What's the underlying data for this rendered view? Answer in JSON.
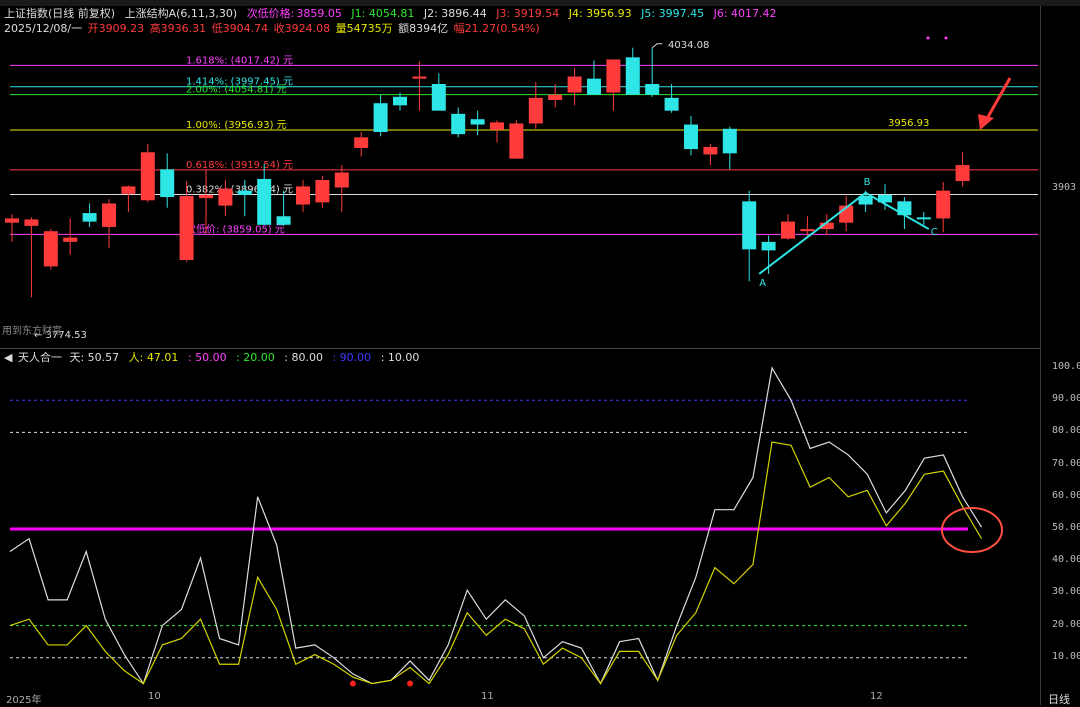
{
  "header1": {
    "index": "上证指数(日线 前复权)",
    "indicator": "上涨结构A(6,11,3,30)",
    "sub_label": "次低价格:",
    "sub_value": "3859.05",
    "j1": "J1: 4054.81",
    "j2": "J2: 3896.44",
    "j3": "J3: 3919.54",
    "j4": "J4: 3956.93",
    "j5": "J5: 3997.45",
    "j6": "J6: 4017.42"
  },
  "header2": {
    "date": "2025/12/08/一",
    "open": "开3909.23",
    "high": "高3936.31",
    "low": "低3904.74",
    "close": "收3924.08",
    "vol": "量54735万",
    "amount": "额8394亿",
    "amp": "幅21.27(0.54%)"
  },
  "fib_labels": [
    {
      "text": "1.618%:  (4017.42) 元",
      "color": "#ff40ff",
      "price": 4017.42
    },
    {
      "text": "1.414%:  (3997.45) 元",
      "color": "#2ee6e6",
      "price": 3997.45
    },
    {
      "text": "2.00%:  (4054.81) 元",
      "color": "#2ee62e",
      "price": 3990
    },
    {
      "text": "1.00%:  (3956.93) 元",
      "color": "#e8e800",
      "price": 3956.93
    },
    {
      "text": "0.618%:  (3919.54) 元",
      "color": "#ff3b3b",
      "price": 3919.54
    },
    {
      "text": "0.382%:  (3896.44) 元",
      "color": "#dddddd",
      "price": 3896.44
    },
    {
      "text": "次低价:  (3859.05) 元",
      "color": "#ff40ff",
      "price": 3859.05
    }
  ],
  "annotations": {
    "high_label": "4034.08",
    "low_label": "3774.53",
    "price_tag": "3956.93",
    "right_price": "3903",
    "point_a": "A",
    "point_b": "B",
    "point_c": "C",
    "mini_text": "用到东方财富"
  },
  "lower_header": {
    "name": "天人合一",
    "tian": "天: 50.57",
    "ren": "人: 47.01",
    "l50": ": 50.00",
    "l20": ": 20.00",
    "l80": ": 80.00",
    "l90": ": 90.00",
    "l10": ": 10.00"
  },
  "lower_ticks": [
    "100.0",
    "90.00",
    "80.00",
    "70.00",
    "60.00",
    "50.00",
    "40.00",
    "30.00",
    "20.00",
    "10.00"
  ],
  "date_labels": [
    "2025年",
    "10",
    "11",
    "12"
  ],
  "day_button": "日线",
  "colors": {
    "up": "#ff3b3b",
    "down": "#2ee6e6",
    "tian": "#dddddd",
    "ren": "#d4d400",
    "magenta": "#ff00ff"
  },
  "chart_data": [
    {
      "type": "candlestick",
      "title": "上证指数(日线 前复权)",
      "ylim": [
        3760,
        4045
      ],
      "candles": [
        {
          "o": 3870,
          "h": 3878,
          "l": 3852,
          "c": 3874
        },
        {
          "o": 3867,
          "h": 3875,
          "l": 3800,
          "c": 3873
        },
        {
          "o": 3829,
          "h": 3864,
          "l": 3826,
          "c": 3862
        },
        {
          "o": 3852,
          "h": 3874,
          "l": 3840,
          "c": 3856
        },
        {
          "o": 3879,
          "h": 3888,
          "l": 3866,
          "c": 3871
        },
        {
          "o": 3866,
          "h": 3892,
          "l": 3846,
          "c": 3888
        },
        {
          "o": 3897,
          "h": 3905,
          "l": 3880,
          "c": 3904
        },
        {
          "o": 3891,
          "h": 3944,
          "l": 3889,
          "c": 3936
        },
        {
          "o": 3920,
          "h": 3935,
          "l": 3884,
          "c": 3894
        },
        {
          "o": 3835,
          "h": 3909,
          "l": 3833,
          "c": 3895
        },
        {
          "o": 3893,
          "h": 3920,
          "l": 3860,
          "c": 3896
        },
        {
          "o": 3886,
          "h": 3910,
          "l": 3876,
          "c": 3902
        },
        {
          "o": 3900,
          "h": 3910,
          "l": 3876,
          "c": 3896
        },
        {
          "o": 3911,
          "h": 3925,
          "l": 3868,
          "c": 3868
        },
        {
          "o": 3876,
          "h": 3900,
          "l": 3867,
          "c": 3868
        },
        {
          "o": 3887,
          "h": 3910,
          "l": 3880,
          "c": 3904
        },
        {
          "o": 3889,
          "h": 3914,
          "l": 3884,
          "c": 3910
        },
        {
          "o": 3903,
          "h": 3924,
          "l": 3880,
          "c": 3917
        },
        {
          "o": 3940,
          "h": 3955,
          "l": 3932,
          "c": 3950
        },
        {
          "o": 3982,
          "h": 3990,
          "l": 3951,
          "c": 3955
        },
        {
          "o": 3988,
          "h": 3992,
          "l": 3975,
          "c": 3980
        },
        {
          "o": 4005,
          "h": 4021,
          "l": 3975,
          "c": 4007
        },
        {
          "o": 4000,
          "h": 4010,
          "l": 3975,
          "c": 3975
        },
        {
          "o": 3972,
          "h": 3978,
          "l": 3950,
          "c": 3953
        },
        {
          "o": 3967,
          "h": 3975,
          "l": 3952,
          "c": 3962
        },
        {
          "o": 3957,
          "h": 3966,
          "l": 3945,
          "c": 3964
        },
        {
          "o": 3930,
          "h": 3966,
          "l": 3930,
          "c": 3963
        },
        {
          "o": 3963,
          "h": 4002,
          "l": 3958,
          "c": 3987
        },
        {
          "o": 3985,
          "h": 4000,
          "l": 3978,
          "c": 3990
        },
        {
          "o": 3992,
          "h": 4015,
          "l": 3980,
          "c": 4007
        },
        {
          "o": 4005,
          "h": 4022,
          "l": 3990,
          "c": 3990
        },
        {
          "o": 3992,
          "h": 4010,
          "l": 3975,
          "c": 4023
        },
        {
          "o": 4025,
          "h": 4034,
          "l": 3990,
          "c": 3990
        },
        {
          "o": 4000,
          "h": 4034,
          "l": 3988,
          "c": 3990
        },
        {
          "o": 3987,
          "h": 4000,
          "l": 3973,
          "c": 3975
        },
        {
          "o": 3962,
          "h": 3970,
          "l": 3933,
          "c": 3939
        },
        {
          "o": 3934,
          "h": 3944,
          "l": 3924,
          "c": 3941
        },
        {
          "o": 3958,
          "h": 3960,
          "l": 3920,
          "c": 3935
        },
        {
          "o": 3890,
          "h": 3900,
          "l": 3815,
          "c": 3845
        },
        {
          "o": 3852,
          "h": 3858,
          "l": 3822,
          "c": 3844
        },
        {
          "o": 3855,
          "h": 3878,
          "l": 3854,
          "c": 3871
        },
        {
          "o": 3862,
          "h": 3876,
          "l": 3857,
          "c": 3864
        },
        {
          "o": 3864,
          "h": 3878,
          "l": 3858,
          "c": 3870
        },
        {
          "o": 3870,
          "h": 3895,
          "l": 3862,
          "c": 3886
        },
        {
          "o": 3895,
          "h": 3900,
          "l": 3880,
          "c": 3887
        },
        {
          "o": 3896,
          "h": 3906,
          "l": 3882,
          "c": 3889
        },
        {
          "o": 3890,
          "h": 3894,
          "l": 3864,
          "c": 3877
        },
        {
          "o": 3875,
          "h": 3880,
          "l": 3868,
          "c": 3874
        },
        {
          "o": 3874,
          "h": 3908,
          "l": 3861,
          "c": 3900
        },
        {
          "o": 3909,
          "h": 3936,
          "l": 3904,
          "c": 3924
        }
      ]
    },
    {
      "type": "line",
      "title": "天人合一",
      "ylim": [
        0,
        100
      ],
      "hlines": [
        {
          "name": "50.00",
          "value": 50,
          "color": "#ff00ff"
        },
        {
          "name": "20.00",
          "value": 20,
          "color": "#2ee62e"
        },
        {
          "name": "80.00",
          "value": 80,
          "color": "#dddddd"
        },
        {
          "name": "90.00",
          "value": 90,
          "color": "#3a3aff"
        },
        {
          "name": "10.00",
          "value": 10,
          "color": "#dddddd"
        }
      ],
      "series": [
        {
          "name": "天",
          "color": "#dddddd",
          "values": [
            43,
            47,
            28,
            28,
            43,
            22,
            11,
            2,
            20,
            25,
            41,
            16,
            14,
            60,
            45,
            13,
            14,
            10,
            5,
            2,
            3,
            9,
            3,
            14,
            31,
            22,
            28,
            23,
            10,
            15,
            13,
            2,
            15,
            16,
            3,
            20,
            35,
            56,
            56,
            66,
            100,
            90,
            75,
            77,
            73,
            67,
            55,
            62,
            72,
            73,
            60,
            50.57
          ]
        },
        {
          "name": "人",
          "color": "#d4d400",
          "values": [
            20,
            22,
            14,
            14,
            20,
            12,
            6,
            2,
            14,
            16,
            22,
            8,
            8,
            35,
            25,
            8,
            11,
            8,
            4,
            2,
            3,
            7,
            2,
            11,
            24,
            17,
            22,
            19,
            8,
            13,
            10,
            2,
            12,
            12,
            3,
            17,
            24,
            38,
            33,
            39,
            77,
            76,
            63,
            66,
            60,
            62,
            51,
            58,
            67,
            68,
            57,
            47.01
          ]
        }
      ]
    }
  ]
}
